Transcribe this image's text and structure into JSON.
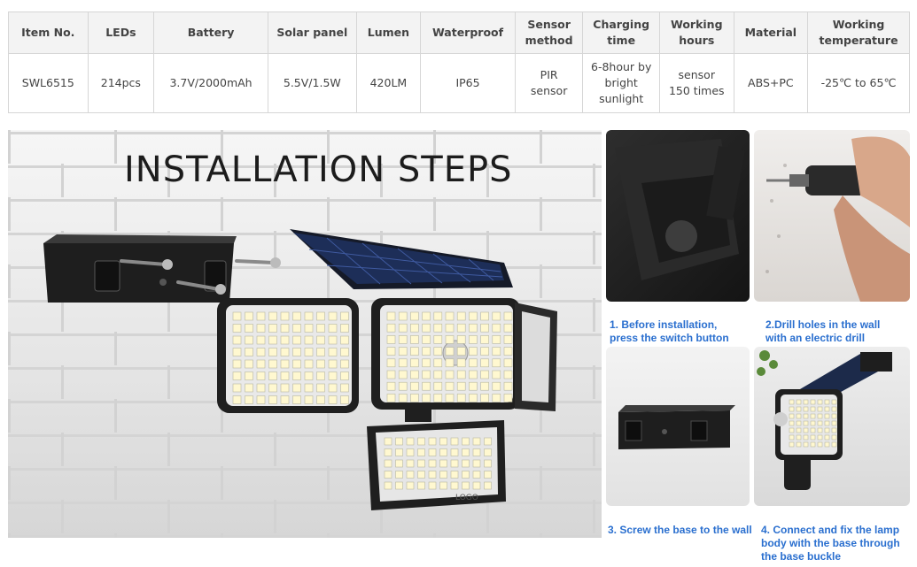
{
  "spec_table": {
    "headers": [
      "Item No.",
      "LEDs",
      "Battery",
      "Solar panel",
      "Lumen",
      "Waterproof",
      "Sensor\nmethod",
      "Charging\ntime",
      "Working\nhours",
      "Material",
      "Working\ntemperature"
    ],
    "row": [
      "SWL6515",
      "214pcs",
      "3.7V/2000mAh",
      "5.5V/1.5W",
      "420LM",
      "IP65",
      "PIR\nsensor",
      "6-8hour by\nbright\nsunlight",
      "sensor\n150 times",
      "ABS+PC",
      "-25℃  to 65℃"
    ]
  },
  "hero": {
    "title": "INSTALLATION STEPS",
    "lamp_logo": "LOGO"
  },
  "steps": [
    {
      "caption": "1. Before installation,\npress the switch button"
    },
    {
      "caption": "2.Drill holes in the wall\nwith an electric drill"
    },
    {
      "caption": "3. Screw the base to the wall"
    },
    {
      "caption": "4. Connect and fix the lamp\nbody with the base through\nthe base buckle"
    }
  ],
  "colors": {
    "caption_blue": "#2a6fcf",
    "table_header_bg": "#f3f3f3",
    "table_border": "#d6d6d6",
    "led_warm_white": "#fff8d0",
    "lamp_body": "#2b2b2b"
  }
}
